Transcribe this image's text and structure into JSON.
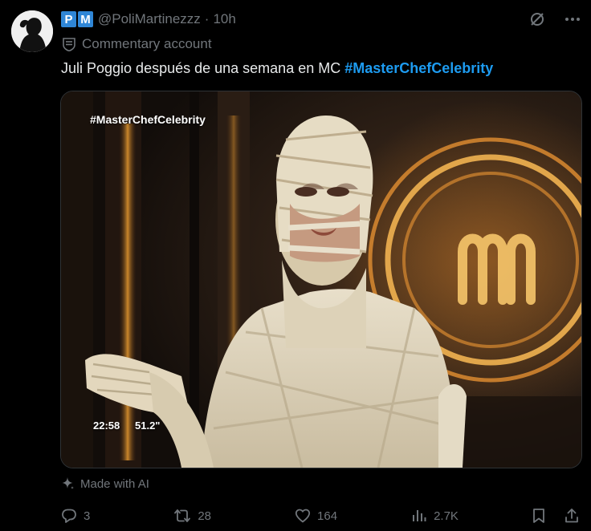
{
  "post": {
    "badge": [
      "P",
      "M"
    ],
    "handle": "@PoliMartinezzz",
    "separator": "·",
    "time": "10h",
    "account_label": "Commentary account",
    "text_prefix": "Juli Poggio después de una semana en MC ",
    "hashtag": "#MasterChefCelebrity"
  },
  "media": {
    "overlay_tag": "#MasterChefCelebrity",
    "timer_left": "22:58",
    "timer_right": "51.2\""
  },
  "ai_label": "Made with AI",
  "actions": {
    "replies": "3",
    "reposts": "28",
    "likes": "164",
    "views": "2.7K"
  },
  "colors": {
    "background": "#000000",
    "text": "#e7e9ea",
    "muted": "#71767b",
    "link": "#1d9bf0",
    "badge": "#2f86d6"
  },
  "icons": {
    "grok": "grok-icon",
    "more": "more-icon",
    "commentary": "commentary-icon",
    "sparkle": "sparkle-icon",
    "reply": "reply-icon",
    "repost": "repost-icon",
    "like": "like-icon",
    "views": "views-icon",
    "bookmark": "bookmark-icon",
    "share": "share-icon"
  }
}
